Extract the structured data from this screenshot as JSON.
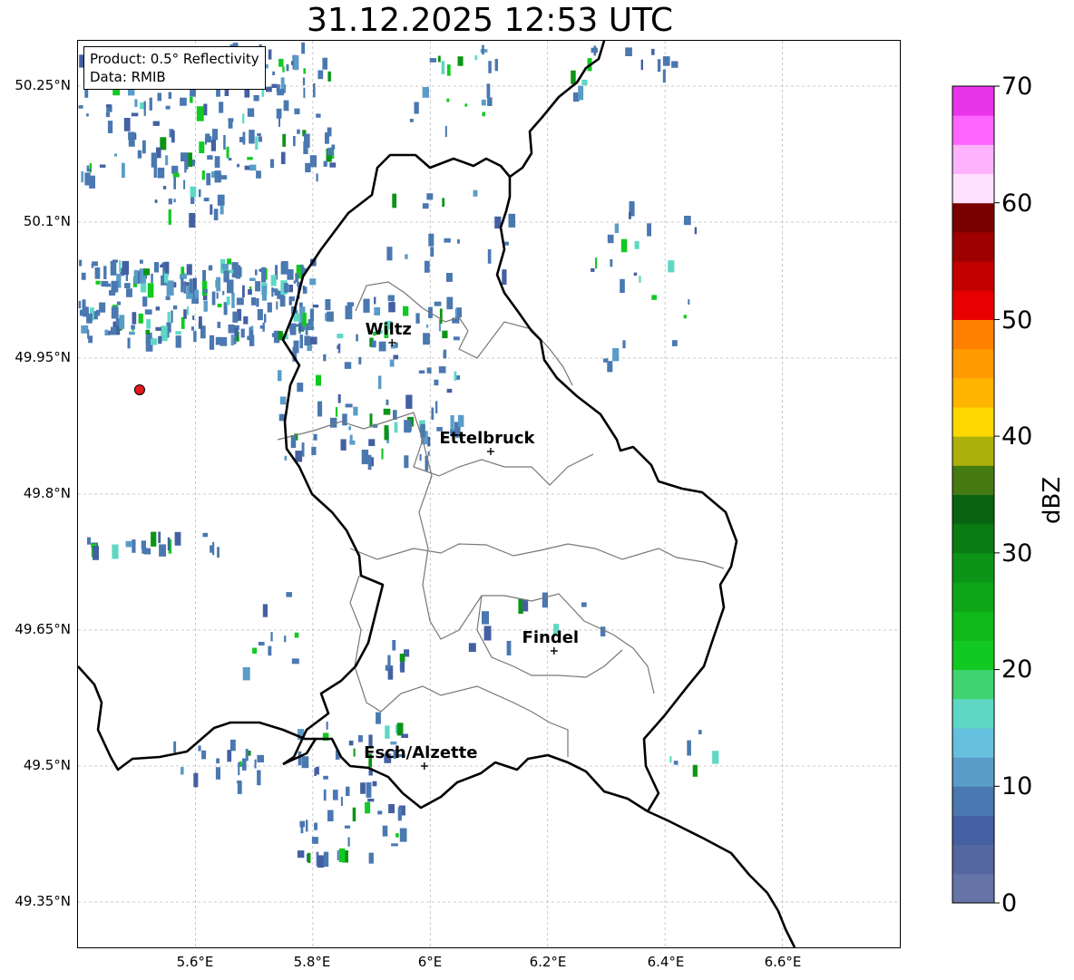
{
  "title": "31.12.2025 12:53 UTC",
  "info": {
    "product_line": "Product: 0.5° Reflectivity",
    "data_line": "Data: RMIB"
  },
  "map": {
    "lon_range": [
      5.4,
      6.8
    ],
    "lat_range": [
      49.3,
      50.3
    ],
    "lon_ticks": [
      "5.6°E",
      "5.8°E",
      "6°E",
      "6.2°E",
      "6.4°E",
      "6.6°E"
    ],
    "lat_ticks": [
      "50.25°N",
      "50.1°N",
      "49.95°N",
      "49.8°N",
      "49.65°N",
      "49.5°N",
      "49.35°N"
    ],
    "grid": true,
    "radar_site": {
      "lon": 5.505,
      "lat": 49.915,
      "color": "#e41a1c"
    },
    "cities": [
      {
        "name": "Wiltz",
        "lon": 5.935,
        "lat": 49.967
      },
      {
        "name": "Ettelbruck",
        "lon": 6.103,
        "lat": 49.847
      },
      {
        "name": "Findel",
        "lon": 6.211,
        "lat": 49.627
      },
      {
        "name": "Esch/Alzette",
        "lon": 5.99,
        "lat": 49.5
      }
    ]
  },
  "colorbar": {
    "label": "dBZ",
    "min": 0,
    "max": 70,
    "ticks": [
      "0",
      "10",
      "20",
      "30",
      "40",
      "50",
      "60",
      "70"
    ],
    "colors": [
      "#6673a6",
      "#5567a0",
      "#4460a2",
      "#4a78b0",
      "#5a9cc8",
      "#64c0dc",
      "#5ed8c4",
      "#40d470",
      "#12c922",
      "#10b81a",
      "#0ea618",
      "#0c9416",
      "#0a7c14",
      "#086410",
      "#457a12",
      "#acb00a",
      "#ffd700",
      "#ffb400",
      "#ff9a00",
      "#ff7f00",
      "#e60000",
      "#c20000",
      "#9e0000",
      "#7a0000",
      "#ffe0ff",
      "#ffb3ff",
      "#ff66ff",
      "#e935e9"
    ]
  }
}
